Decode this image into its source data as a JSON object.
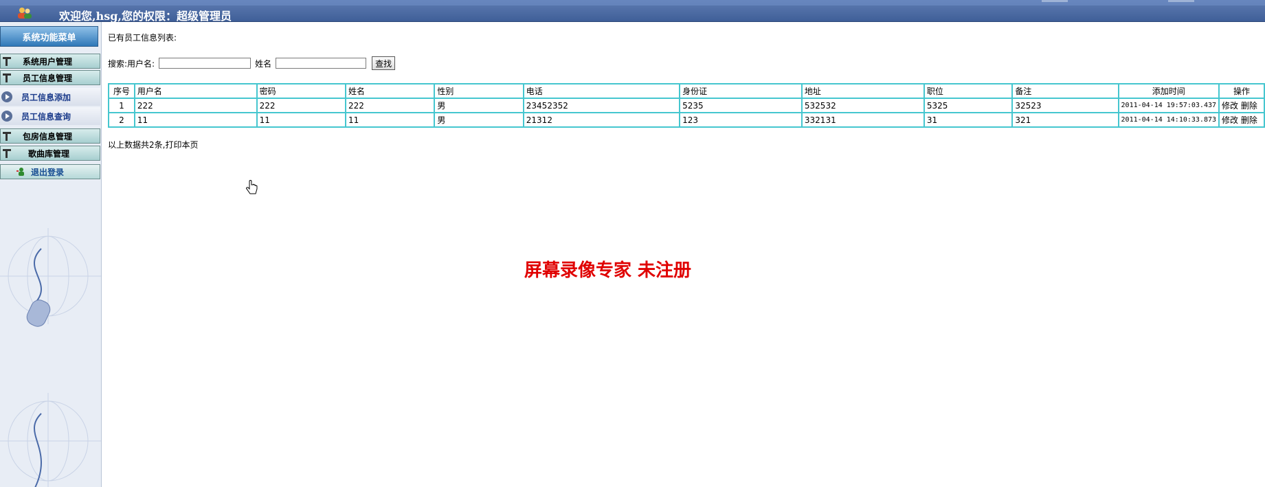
{
  "header": {
    "welcome_text": "欢迎您,hsg,您的权限：超级管理员"
  },
  "sidebar": {
    "title": "系统功能菜单",
    "items": [
      {
        "label": "系统用户管理",
        "type": "group"
      },
      {
        "label": "员工信息管理",
        "type": "group"
      },
      {
        "label": "员工信息添加",
        "type": "sub"
      },
      {
        "label": "员工信息查询",
        "type": "sub"
      },
      {
        "label": "包房信息管理",
        "type": "group"
      },
      {
        "label": "歌曲库管理",
        "type": "group"
      }
    ],
    "logout_label": "退出登录"
  },
  "main": {
    "list_title": "已有员工信息列表:",
    "search": {
      "prefix_label": "搜索:用户名:",
      "username_value": "",
      "name_label": "姓名",
      "name_value": "",
      "button_label": "查找"
    },
    "table": {
      "headers": [
        "序号",
        "用户名",
        "密码",
        "姓名",
        "性别",
        "电话",
        "身份证",
        "地址",
        "职位",
        "备注",
        "添加时间",
        "操作"
      ],
      "rows": [
        {
          "no": "1",
          "username": "222",
          "password": "222",
          "name": "222",
          "gender": "男",
          "phone": "23452352",
          "id_card": "5235",
          "address": "532532",
          "position": "5325",
          "remark": "32523",
          "added": "2011-04-14 19:57:03.437",
          "edit": "修改",
          "delete": "删除"
        },
        {
          "no": "2",
          "username": "11",
          "password": "11",
          "name": "11",
          "gender": "男",
          "phone": "21312",
          "id_card": "123",
          "address": "332131",
          "position": "31",
          "remark": "321",
          "added": "2011-04-14 14:10:33.873",
          "edit": "修改",
          "delete": "删除"
        }
      ]
    },
    "summary_text": "以上数据共2条,打印本页",
    "watermark_text": "屏幕录像专家 未注册"
  },
  "colors": {
    "topbar": "#4a68a0",
    "table_border": "#45c6cf",
    "watermark": "#e00000",
    "submenu_text": "#1a3a8a"
  }
}
